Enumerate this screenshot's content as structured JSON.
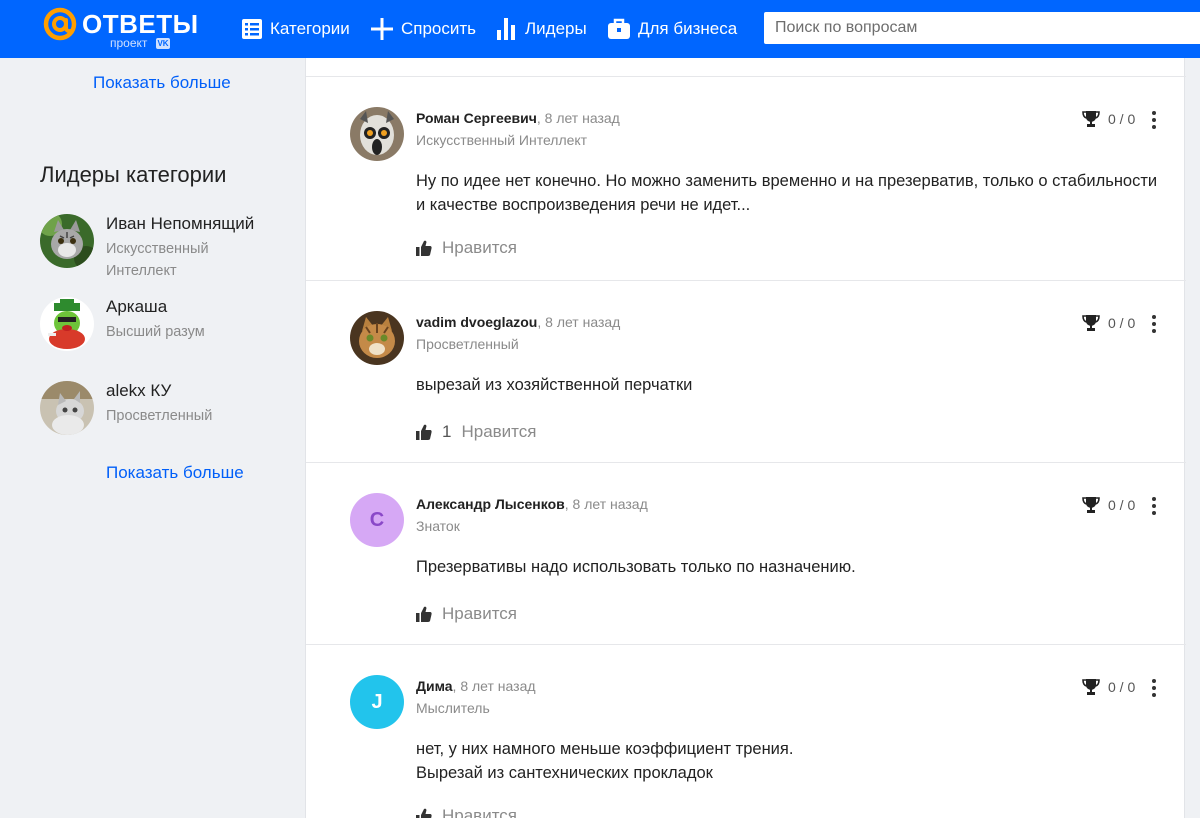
{
  "header": {
    "logo_text": "ОТВЕТЫ",
    "logo_sub": "проект",
    "logo_badge": "VK",
    "nav": [
      {
        "label": "Категории",
        "icon": "list-icon"
      },
      {
        "label": "Спросить",
        "icon": "plus-icon"
      },
      {
        "label": "Лидеры",
        "icon": "bar-chart-icon"
      },
      {
        "label": "Для бизнеса",
        "icon": "briefcase-icon"
      }
    ],
    "search_placeholder": "Поиск по вопросам"
  },
  "sidebar": {
    "show_more_top": "Показать больше",
    "leaders_title": "Лидеры категории",
    "leaders": [
      {
        "name": "Иван Непомнящий",
        "rank": "Искусственный Интеллект",
        "avatar": "cat-photo-avatar"
      },
      {
        "name": "Аркаша",
        "rank": "Высший разум",
        "avatar": "cartoon-avatar"
      },
      {
        "name": "alekx КУ",
        "rank": "Просветленный",
        "avatar": "kitten-photo-avatar"
      }
    ],
    "show_more_bottom": "Показать больше"
  },
  "answers": [
    {
      "author": "Роман Сергеевич",
      "time": ", 8 лет назад",
      "rank": "Искусственный Интеллект",
      "text": "Ну по идее нет конечно. Но можно заменить временно и на презерватив, только о стабильности и качестве воспроизведения речи не идет...",
      "likes": "",
      "like_label": "Нравится",
      "score": "0 / 0",
      "avatar": "lemur-photo-avatar"
    },
    {
      "author": "vadim dvoeglazou",
      "time": ", 8 лет назад",
      "rank": "Просветленный",
      "text": "вырезай из хозяйственной перчатки",
      "likes": "1",
      "like_label": "Нравится",
      "score": "0 / 0",
      "avatar": "cat-photo-avatar"
    },
    {
      "author": "Александр Лысенков",
      "time": ", 8 лет назад",
      "rank": "Знаток",
      "text": "Презервативы надо использовать только по назначению.",
      "likes": "",
      "like_label": "Нравится",
      "score": "0 / 0",
      "avatar_letter": "C",
      "avatar_color": "#d6a8f5",
      "avatar_text_color": "#8a48c8"
    },
    {
      "author": "Дима",
      "time": ", 8 лет назад",
      "rank": "Мыслитель",
      "text_lines": [
        "нет, у них намного меньше коэффициент трения.",
        "Вырезай из сантехнических прокладок"
      ],
      "likes": "",
      "like_label": "Нравится",
      "score": "0 / 0",
      "avatar_letter": "J",
      "avatar_color": "#22c4ec",
      "avatar_text_color": "#ffffff"
    }
  ],
  "colors": {
    "brand": "#0066ff",
    "logo_accent": "#ff9e00",
    "link": "#005ff9",
    "background": "#eff1f4"
  }
}
